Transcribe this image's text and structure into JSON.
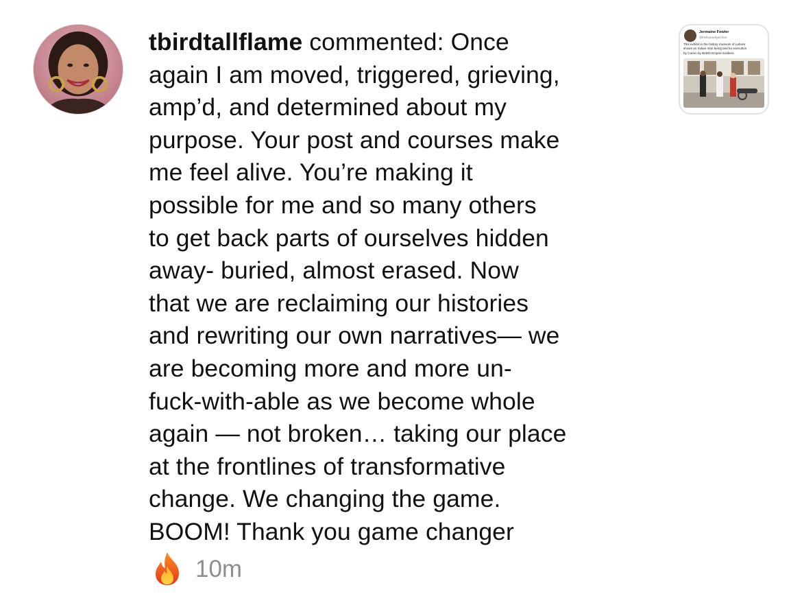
{
  "notification": {
    "username": "tbirdtallflame",
    "comment_lines": [
      " commented: Once",
      "again I am moved, triggered, grieving,",
      "amp’d, and determined about my",
      "purpose. Your post and courses make",
      "me feel alive. You’re making it",
      "possible for me and so many others",
      "to get back parts of ourselves hidden",
      "away- buried, almost erased. Now",
      "that we are reclaiming our histories",
      "and rewriting our own narratives— we",
      "are becoming more and more un-",
      "fuck-with-able as we become whole",
      "again — not broken… taking our place",
      "at the frontlines of transformative",
      "change. We changing the game.",
      "BOOM! Thank you game changer"
    ],
    "emoji_icon": "fire-icon",
    "timestamp": "10m",
    "avatar_icon": "user-avatar"
  },
  "post_thumbnail": {
    "author_name": "Jermaine Fowler",
    "author_handle": "@thehumanityarchive",
    "caption_lines": [
      "This exhibit in the history museum of Lahore",
      "shows an Indian man being tied for execution",
      "by Canon by British Empire Soldiers."
    ]
  },
  "colors": {
    "text": "#111111",
    "timestamp": "#8e8e8e",
    "thumbnail_border": "#e2e2e2"
  }
}
